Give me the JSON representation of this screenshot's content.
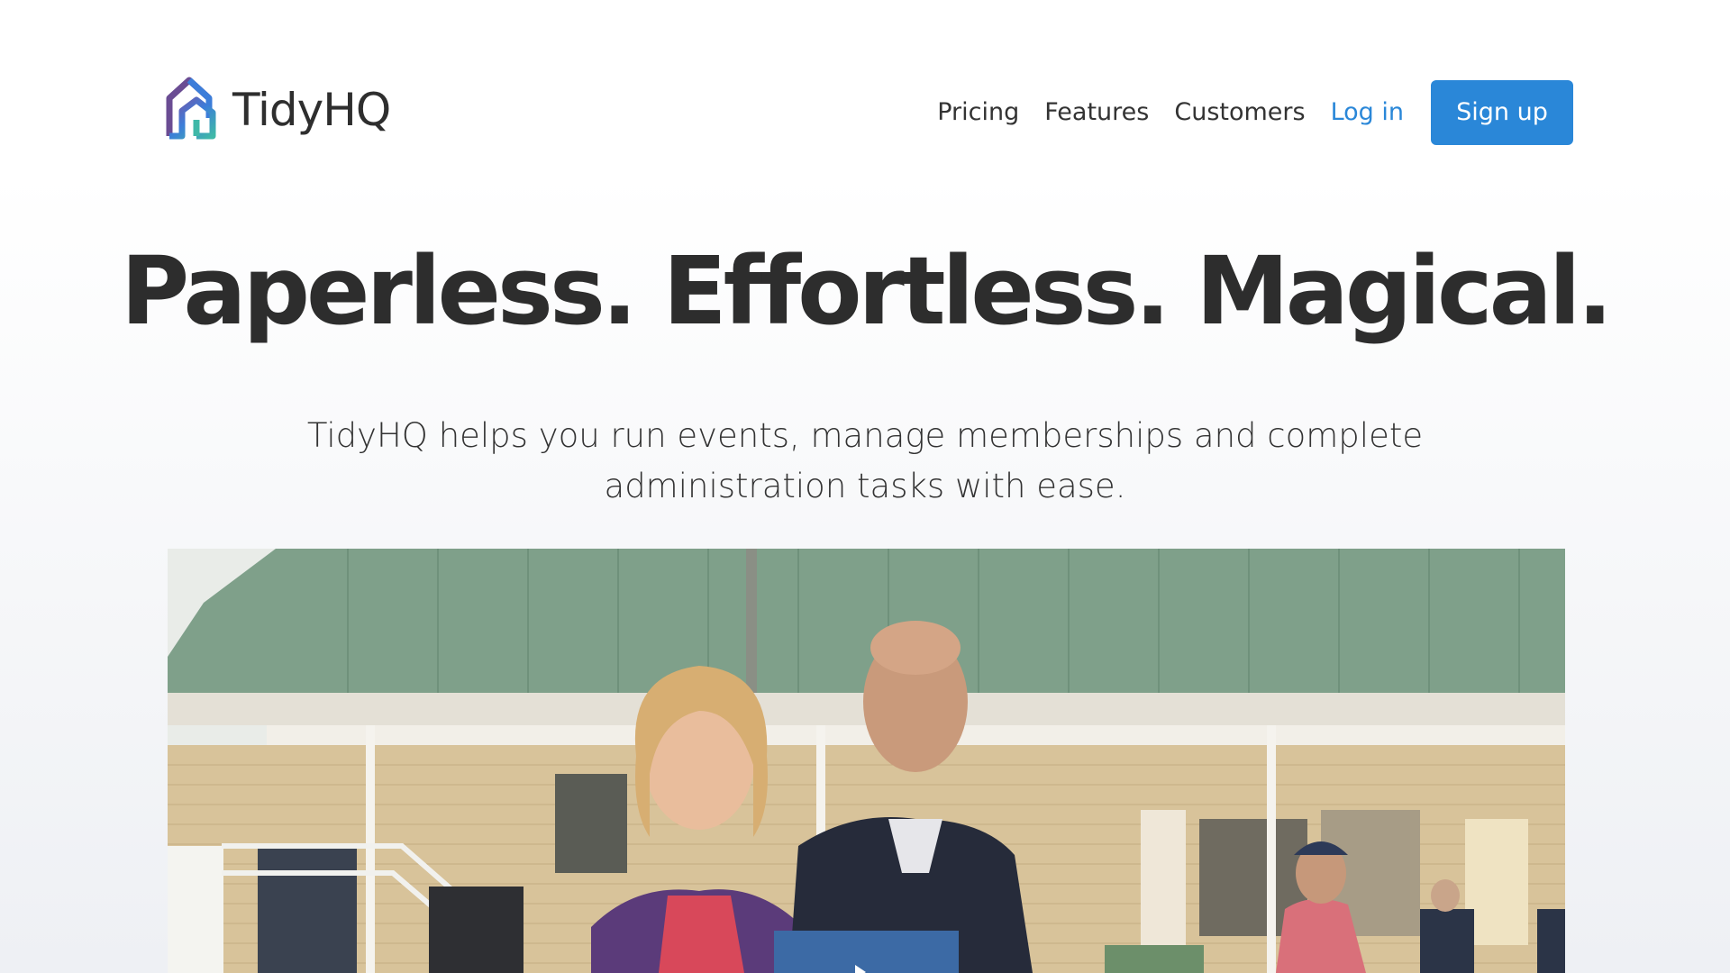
{
  "brand": {
    "name": "TidyHQ",
    "colors": {
      "accent": "#2a87d8",
      "logo_purple": "#6a4c93",
      "logo_teal": "#3fb8a8",
      "logo_blue": "#3c7dd9",
      "play_button": "#3c6aa5"
    }
  },
  "nav": {
    "items": [
      {
        "label": "Pricing"
      },
      {
        "label": "Features"
      },
      {
        "label": "Customers"
      }
    ],
    "login_label": "Log in",
    "signup_label": "Sign up"
  },
  "hero": {
    "headline": "Paperless. Effortless. Magical.",
    "subheadline": "TidyHQ helps you run events, manage memberships and complete administration tasks with ease."
  },
  "video": {
    "icon": "play-icon"
  }
}
